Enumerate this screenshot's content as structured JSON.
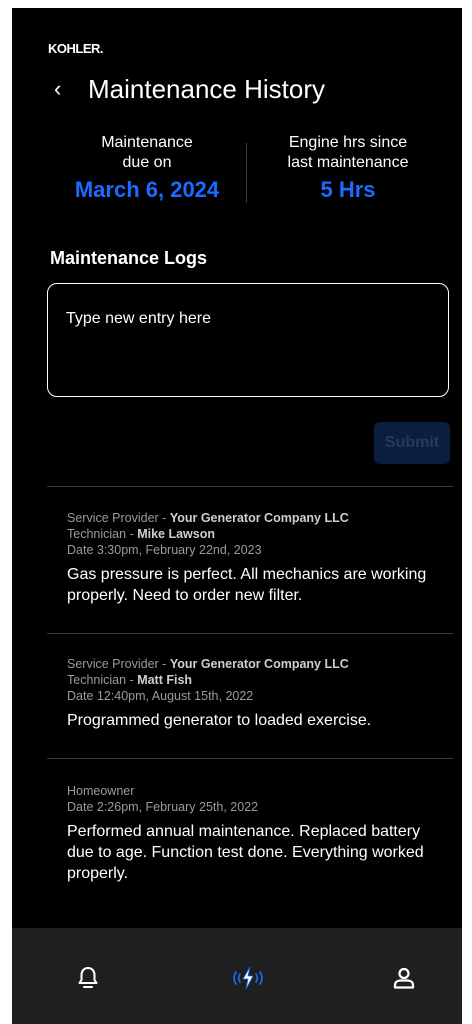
{
  "brand": "KOHLER.",
  "header": {
    "back_label": "‹",
    "title": "Maintenance History"
  },
  "stats": {
    "due": {
      "label_line1": "Maintenance",
      "label_line2": "due on",
      "value": "March 6, 2024"
    },
    "hours": {
      "label_line1": "Engine hrs since",
      "label_line2": "last maintenance",
      "value": "5 Hrs"
    }
  },
  "logs_section": {
    "title": "Maintenance Logs",
    "entry_placeholder": "Type new entry here",
    "submit_label": "Submit"
  },
  "logs": [
    {
      "provider_prefix": "Service Provider - ",
      "provider": "Your Generator Company LLC",
      "tech_prefix": "Technician - ",
      "technician": "Mike Lawson",
      "date": "Date 3:30pm, February 22nd, 2023",
      "note": "Gas pressure is perfect. All mechanics are working properly. Need to order new filter."
    },
    {
      "provider_prefix": "Service Provider - ",
      "provider": "Your Generator Company LLC",
      "tech_prefix": "Technician - ",
      "technician": "Matt Fish",
      "date": "Date 12:40pm, August 15th, 2022",
      "note": "Programmed generator to loaded exercise."
    },
    {
      "role": "Homeowner",
      "date": "Date 2:26pm, February 25th, 2022",
      "note": "Performed annual maintenance. Replaced battery due to age. Function test done. Everything worked properly."
    }
  ],
  "nav": {
    "items": [
      {
        "icon": "bell-icon"
      },
      {
        "icon": "power-bolt-icon"
      },
      {
        "icon": "user-icon"
      }
    ]
  },
  "colors": {
    "accent": "#1a6bff",
    "background": "#000000",
    "nav_background": "#1f1f1f"
  }
}
